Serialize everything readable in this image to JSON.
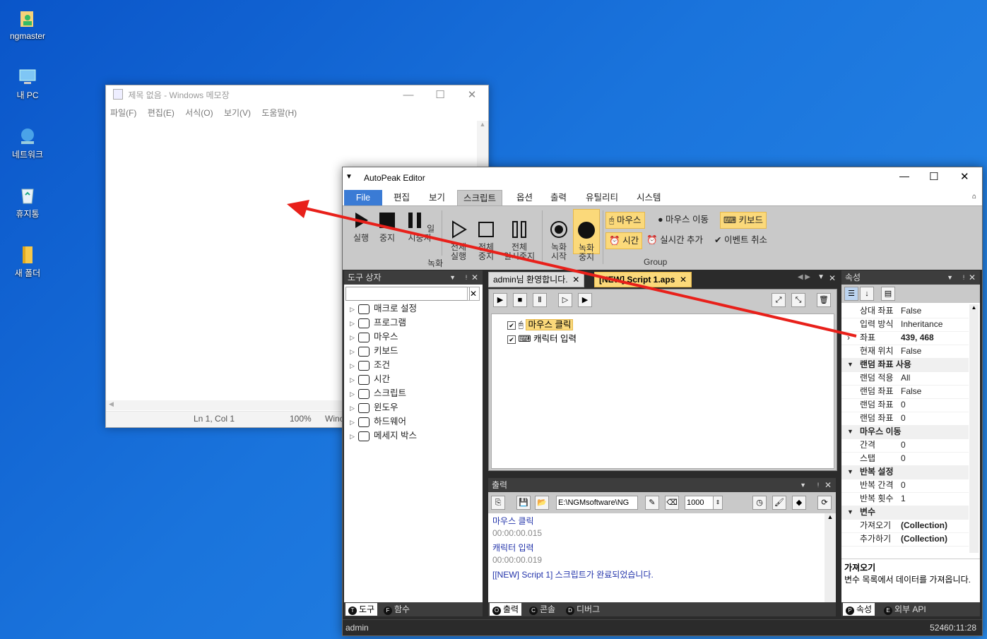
{
  "desktop": {
    "icons": [
      {
        "label": "ngmaster",
        "icon": "user-folder-icon"
      },
      {
        "label": "내 PC",
        "icon": "pc-icon"
      },
      {
        "label": "네트워크",
        "icon": "network-icon"
      },
      {
        "label": "휴지통",
        "icon": "recycle-bin-icon"
      },
      {
        "label": "새 폴더",
        "icon": "folder-icon"
      }
    ]
  },
  "notepad": {
    "title": "제목 없음 - Windows 메모장",
    "menu": [
      "파일(F)",
      "편집(E)",
      "서식(O)",
      "보기(V)",
      "도움말(H)"
    ],
    "status": {
      "position": "Ln 1, Col 1",
      "zoom": "100%",
      "encoding": "Winc"
    }
  },
  "autopeak": {
    "title": "AutoPeak Editor",
    "ribbon_tabs": [
      "File",
      "편집",
      "보기",
      "스크립트",
      "옵션",
      "출력",
      "유틸리티",
      "시스템"
    ],
    "active_tab": "스크립트",
    "groups": {
      "run": {
        "buttons": [
          {
            "label": "실행"
          },
          {
            "label": "중지"
          },
          {
            "label": "일시중지"
          },
          {
            "label": "전체\n실행"
          },
          {
            "label": "전체\n중지"
          },
          {
            "label": "전체\n일시중지"
          }
        ]
      },
      "record": {
        "label": "녹화",
        "buttons": [
          {
            "label": "녹화\n시작"
          },
          {
            "label": "녹화\n중지"
          }
        ]
      },
      "event": {
        "label": "Group",
        "buttons": [
          {
            "label": "마우스"
          },
          {
            "label": "마우스 이동"
          },
          {
            "label": "키보드"
          },
          {
            "label": "시간"
          },
          {
            "label": "실시간 추가"
          },
          {
            "label": "이벤트 취소"
          }
        ]
      }
    },
    "toolbox": {
      "title": "도구 상자",
      "search_value": "",
      "items": [
        "매크로 설정",
        "프로그램",
        "마우스",
        "키보드",
        "조건",
        "시간",
        "스크립트",
        "윈도우",
        "하드웨어",
        "메세지 박스"
      ]
    },
    "doc_tabs": [
      {
        "label": "admin님 환영합니다."
      },
      {
        "label": "[NEW] Script 1.aps"
      }
    ],
    "script_items": [
      {
        "label": "마우스 클릭",
        "checked": true
      },
      {
        "label": "캐릭터 입력",
        "checked": true
      }
    ],
    "output": {
      "title": "출력",
      "path": "E:\\NGMsoftware\\NG",
      "interval": "1000",
      "lines": [
        {
          "text": "마우스 클릭",
          "color": "#2233aa"
        },
        {
          "text": "00:00:00.015",
          "color": "#888888"
        },
        {
          "text": "캐릭터 입력",
          "color": "#2233aa"
        },
        {
          "text": "00:00:00.019",
          "color": "#888888"
        },
        {
          "text": "[[NEW] Script 1] 스크립트가 완료되었습니다.",
          "color": "#2233aa"
        }
      ]
    },
    "properties": {
      "title": "속성",
      "rows": [
        {
          "k": "상대 좌표",
          "v": "False"
        },
        {
          "k": "입력 방식",
          "v": "Inheritance"
        },
        {
          "k": "좌표",
          "v": "439, 468",
          "bold": true
        },
        {
          "k": "현재 위치",
          "v": "False"
        },
        {
          "k": "랜덤 좌표 사용",
          "group": true
        },
        {
          "k": "랜덤 적용",
          "v": "All"
        },
        {
          "k": "랜덤 좌표",
          "v": "False"
        },
        {
          "k": "랜덤 좌표",
          "v": "0"
        },
        {
          "k": "랜덤 좌표",
          "v": "0"
        },
        {
          "k": "마우스 이동",
          "group": true
        },
        {
          "k": "간격",
          "v": "0"
        },
        {
          "k": "스탭",
          "v": "0"
        },
        {
          "k": "반복 설정",
          "group": true
        },
        {
          "k": "반복 간격",
          "v": "0"
        },
        {
          "k": "반복 횟수",
          "v": "1"
        },
        {
          "k": "변수",
          "group": true
        },
        {
          "k": "가져오기",
          "v": "(Collection)",
          "bold": true
        },
        {
          "k": "추가하기",
          "v": "(Collection)",
          "bold": true
        }
      ],
      "desc_title": "가져오기",
      "desc_text": "변수 목록에서 데이터를 가져옵니다."
    },
    "bottom_tabs_left": [
      {
        "key": "T",
        "label": "도구"
      },
      {
        "key": "F",
        "label": "함수"
      }
    ],
    "bottom_tabs_mid": [
      {
        "key": "O",
        "label": "출력"
      },
      {
        "key": "C",
        "label": "콘솔"
      },
      {
        "key": "D",
        "label": "디버그"
      }
    ],
    "bottom_tabs_right": [
      {
        "key": "P",
        "label": "속성"
      },
      {
        "key": "E",
        "label": "외부 API"
      }
    ],
    "status": {
      "user": "admin",
      "right": "52460:11:28"
    }
  },
  "colors": {
    "highlight": "#fbd97a",
    "arrow": "#e8201a",
    "dark": "#2b2b2b"
  }
}
